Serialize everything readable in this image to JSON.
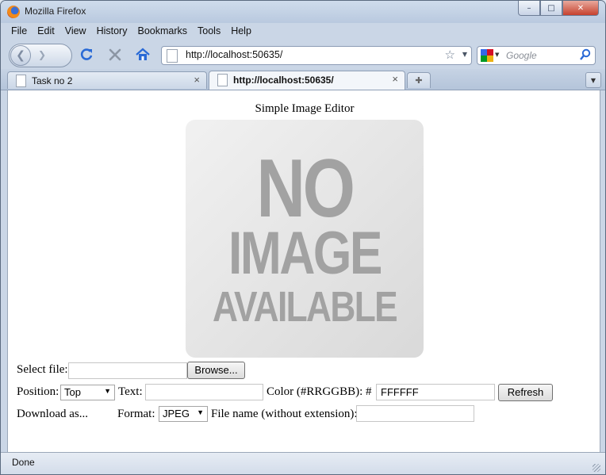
{
  "window": {
    "title": "Mozilla Firefox",
    "minimize": "–",
    "maximize": "□",
    "close": "✕"
  },
  "menu": [
    "File",
    "Edit",
    "View",
    "History",
    "Bookmarks",
    "Tools",
    "Help"
  ],
  "nav": {
    "url": "http://localhost:50635/",
    "search_placeholder": "Google"
  },
  "tabs": [
    {
      "label": "Task no 2",
      "close": "×"
    },
    {
      "label": "http://localhost:50635/",
      "close": "×"
    }
  ],
  "page": {
    "title": "Simple Image Editor",
    "image_text": [
      "NO",
      "IMAGE",
      "AVAILABLE"
    ],
    "select_file_label": "Select file:",
    "browse_label": "Browse...",
    "position_label": "Position:",
    "position_value": "Top",
    "text_label": "Text:",
    "text_value": "",
    "color_label": "Color (#RRGGBB): #",
    "color_value": "FFFFFF",
    "refresh_label": "Refresh",
    "download_label": "Download as...",
    "format_label": "Format:",
    "format_value": "JPEG",
    "filename_label": "File name (without extension):",
    "filename_value": ""
  },
  "status": {
    "text": "Done"
  }
}
